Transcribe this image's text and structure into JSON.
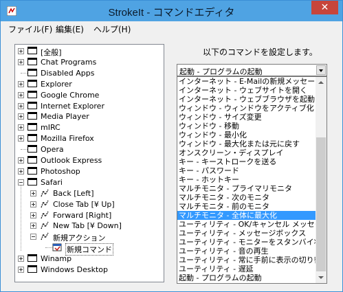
{
  "window": {
    "title": "StrokeIt - コマンドエディタ",
    "close_label": "✕"
  },
  "menu": [
    "ファイル(F)",
    "編集(E)",
    "ヘルプ(H)"
  ],
  "tree": [
    {
      "label": "[全般]",
      "expander": "plus",
      "icon": "window"
    },
    {
      "label": "Chat Programs",
      "expander": "plus",
      "icon": "window"
    },
    {
      "label": "Disabled Apps",
      "expander": "none",
      "icon": "window"
    },
    {
      "label": "Explorer",
      "expander": "plus",
      "icon": "window"
    },
    {
      "label": "Google Chrome",
      "expander": "plus",
      "icon": "window"
    },
    {
      "label": "Internet Explorer",
      "expander": "plus",
      "icon": "window"
    },
    {
      "label": "Media Player",
      "expander": "plus",
      "icon": "window"
    },
    {
      "label": "mIRC",
      "expander": "plus",
      "icon": "window"
    },
    {
      "label": "Mozilla Firefox",
      "expander": "plus",
      "icon": "window"
    },
    {
      "label": "Opera",
      "expander": "none",
      "icon": "window"
    },
    {
      "label": "Outlook Express",
      "expander": "plus",
      "icon": "window"
    },
    {
      "label": "Photoshop",
      "expander": "plus",
      "icon": "window"
    },
    {
      "label": "Safari",
      "expander": "minus",
      "icon": "window"
    },
    {
      "label": "Back [Left]",
      "expander": "plus",
      "icon": "gesture",
      "level": 1
    },
    {
      "label": "Close Tab [¥ Up]",
      "expander": "plus",
      "icon": "gesture",
      "level": 1
    },
    {
      "label": "Forward [Right]",
      "expander": "plus",
      "icon": "gesture",
      "level": 1
    },
    {
      "label": "New Tab [¥ Down]",
      "expander": "plus",
      "icon": "gesture",
      "level": 1
    },
    {
      "label": "新規アクション",
      "expander": "minus",
      "icon": "gesture",
      "level": 1
    },
    {
      "label": "新規コマンド",
      "expander": "none",
      "icon": "command",
      "level": 2,
      "selected": true
    },
    {
      "label": "Winamp",
      "expander": "plus",
      "icon": "window"
    },
    {
      "label": "Windows Desktop",
      "expander": "plus",
      "icon": "window"
    }
  ],
  "command_panel": {
    "label": "以下のコマンドを設定します。",
    "combo_value": "起動 - プログラムの起動",
    "list": [
      "インターネット - E-Mailの新規メッセージ作成",
      "インターネット - ウェブサイトを開く",
      "インターネット - ウェブブラウザを起動",
      "ウィンドウ - ウィンドウをアクティブ化",
      "ウィンドウ - サイズ変更",
      "ウィンドウ - 移動",
      "ウィンドウ - 最小化",
      "ウィンドウ - 最大化または元に戻す",
      "オンスクリーン・ディスプレイ",
      "キー - キーストロークを送る",
      "キー - パスワード",
      "キー - ホットキー",
      "マルチモニタ - プライマリモニタ",
      "マルチモニタ - 次のモニタ",
      "マルチモニタ - 前のモニタ",
      "マルチモニタ - 全体に最大化",
      "ユーティリティ - OK/キャンセル メッセージボックス",
      "ユーティリティ - メッセージボックス",
      "ユーティリティ - モニターをスタンバイ状態に",
      "ユーティリティ - 音の再生",
      "ユーティリティ - 常に手前に表示の切り替え",
      "ユーティリティ - 遅延",
      "起動 - プログラムの起動"
    ],
    "selected_index": 15
  },
  "colors": {
    "titlebar": "#4fa3e3",
    "close": "#c7453b",
    "selection": "#3399ff"
  }
}
